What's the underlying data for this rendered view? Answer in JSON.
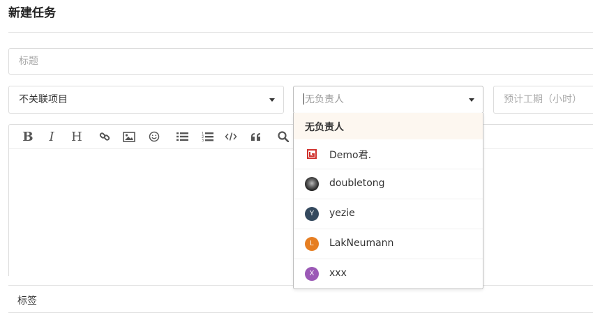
{
  "page": {
    "title": "新建任务"
  },
  "form": {
    "title_placeholder": "标题",
    "project_select": {
      "value": "不关联项目"
    },
    "assignee_select": {
      "placeholder": "无负责人"
    },
    "hours_placeholder": "预计工期（小时）",
    "tags_label": "标签"
  },
  "editor": {
    "toolbar": [
      {
        "name": "bold-button",
        "icon": "bold-icon"
      },
      {
        "name": "italic-button",
        "icon": "italic-icon"
      },
      {
        "name": "heading-button",
        "icon": "heading-icon"
      },
      {
        "name": "link-button",
        "icon": "link-icon"
      },
      {
        "name": "image-button",
        "icon": "image-icon"
      },
      {
        "name": "emoji-button",
        "icon": "smile-icon"
      },
      {
        "name": "bullet-list-button",
        "icon": "list-ul-icon"
      },
      {
        "name": "ordered-list-button",
        "icon": "list-ol-icon"
      },
      {
        "name": "code-button",
        "icon": "code-icon"
      },
      {
        "name": "quote-button",
        "icon": "quote-icon"
      },
      {
        "name": "search-button",
        "icon": "search-icon"
      }
    ]
  },
  "dropdown": {
    "options": [
      {
        "label": "无负责人",
        "highlighted": true
      },
      {
        "label": "Demo君.",
        "avatar": {
          "type": "logo",
          "color": "#d0312d"
        }
      },
      {
        "label": "doubletong",
        "avatar": {
          "type": "photo",
          "color": "#2b2b2b"
        }
      },
      {
        "label": "yezie",
        "avatar": {
          "type": "initial",
          "text": "Y",
          "color": "#34495e"
        }
      },
      {
        "label": "LakNeumann",
        "avatar": {
          "type": "initial",
          "text": "L",
          "color": "#e67e22"
        }
      },
      {
        "label": "xxx",
        "avatar": {
          "type": "initial",
          "text": "X",
          "color": "#9b59b6"
        }
      }
    ]
  }
}
